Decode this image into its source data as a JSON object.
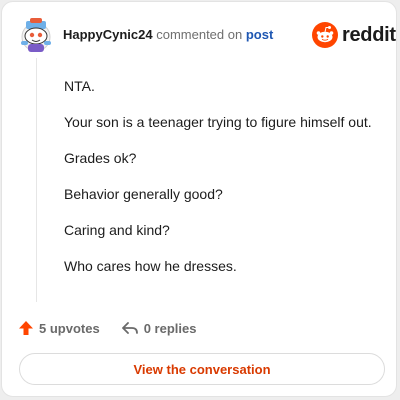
{
  "comment": {
    "username": "HappyCynic24",
    "action_text": "commented on",
    "post_link": "post",
    "paragraphs": [
      "NTA.",
      "Your son is a teenager trying to figure himself out.",
      "Grades ok?",
      "Behavior generally good?",
      "Caring and kind?",
      "Who cares how he dresses."
    ]
  },
  "brand": {
    "name": "reddit",
    "logo_icon": "reddit-snoo-icon",
    "accent_color": "#ff4500"
  },
  "actions": {
    "upvotes_label": "5 upvotes",
    "replies_label": "0 replies"
  },
  "cta": {
    "label": "View the conversation",
    "color": "#d93a00"
  }
}
